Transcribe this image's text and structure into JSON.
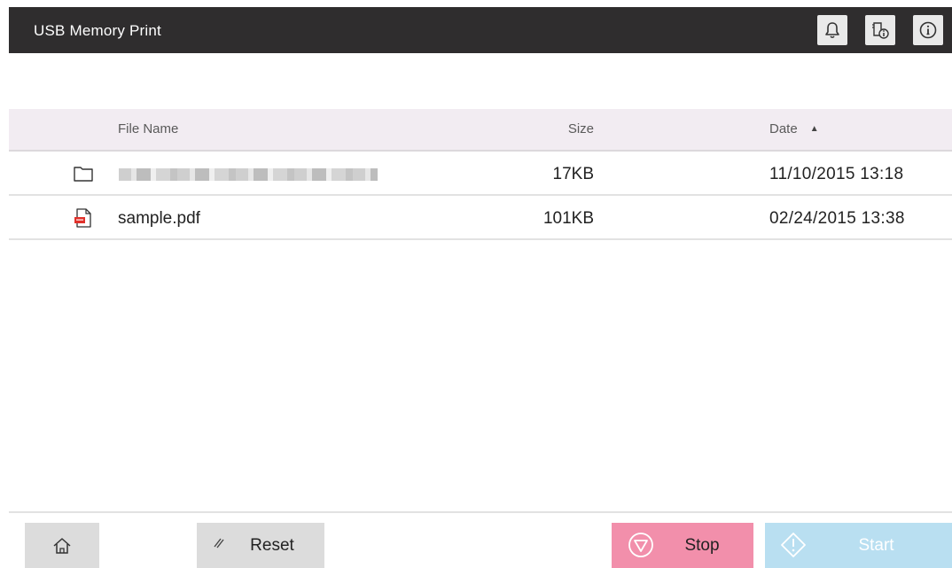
{
  "header": {
    "title": "USB Memory Print",
    "icons": [
      "bell-icon",
      "tray-info-icon",
      "info-icon"
    ],
    "background": "#2f2d2e"
  },
  "table": {
    "columns": {
      "name": "File Name",
      "size": "Size",
      "date": "Date"
    },
    "sort": {
      "column": "Date",
      "direction": "ascending"
    },
    "rows": [
      {
        "type": "folder",
        "icon": "folder-icon",
        "name": "",
        "name_obscured": true,
        "size": "17KB",
        "date": "11/10/2015 13:18"
      },
      {
        "type": "pdf",
        "icon": "pdf-file-icon",
        "name": "sample.pdf",
        "size": "101KB",
        "date": "02/24/2015 13:38"
      }
    ]
  },
  "footer": {
    "home_icon": "home-icon",
    "reset_label": "Reset",
    "stop_label": "Stop",
    "start_label": "Start",
    "colors": {
      "stop": "#f28fab",
      "start": "#b9dff1",
      "neutral": "#dcdcdc"
    }
  }
}
